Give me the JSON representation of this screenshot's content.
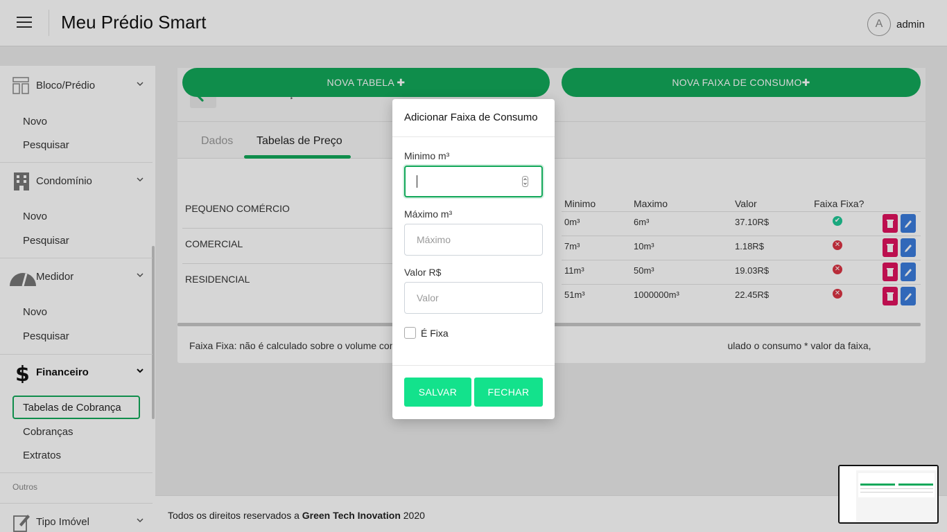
{
  "header": {
    "app_title": "Meu Prédio Smart",
    "avatar_letter": "A",
    "username": "admin"
  },
  "sidebar": {
    "sections": [
      {
        "label": "Bloco/Prédio",
        "items": [
          "Novo",
          "Pesquisar"
        ]
      },
      {
        "label": "Condomínio",
        "items": [
          "Novo",
          "Pesquisar"
        ]
      },
      {
        "label": "Medidor",
        "items": [
          "Novo",
          "Pesquisar"
        ]
      },
      {
        "label": "Financeiro",
        "items": [
          "Tabelas de Cobrança",
          "Cobranças",
          "Extratos"
        ]
      },
      {
        "label": "Tipo Imóvel",
        "items": []
      }
    ],
    "group_label": "Outros"
  },
  "page": {
    "title": "Tabelas de Preços da Concessionária",
    "tabs": [
      "Dados",
      "Tabelas de Preço"
    ],
    "active_tab": "Tabelas de Preço",
    "new_table_button": "NOVA TABELA",
    "new_band_button": "NOVA FAIXA DE CONSUMO",
    "price_tables": [
      "PEQUENO COMÉRCIO",
      "COMERCIAL",
      "RESIDENCIAL"
    ],
    "bands_columns": [
      "Minimo",
      "Maximo",
      "Valor",
      "Faixa Fixa?"
    ],
    "bands": [
      {
        "min": "0m³",
        "max": "6m³",
        "value": "37.10R$",
        "fixed": true
      },
      {
        "min": "7m³",
        "max": "10m³",
        "value": "1.18R$",
        "fixed": false
      },
      {
        "min": "11m³",
        "max": "50m³",
        "value": "19.03R$",
        "fixed": false
      },
      {
        "min": "51m³",
        "max": "1000000m³",
        "value": "22.45R$",
        "fixed": false
      }
    ],
    "note_left": "Faixa Fixa: não é calculado sobre o volume con",
    "note_right": "ulado o consumo * valor da faixa,"
  },
  "footer": {
    "prefix": "Todos os direitos reservados a",
    "company": "Green Tech Inovation",
    "year": "2020"
  },
  "modal": {
    "title": "Adicionar Faixa de Consumo",
    "min_label": "Minimo m³",
    "min_value": "",
    "max_label": "Máximo m³",
    "max_placeholder": "Máximo",
    "value_label": "Valor R$",
    "value_placeholder": "Valor",
    "fixed_label": "É Fixa",
    "fixed_checked": false,
    "save_button": "SALVAR",
    "close_button": "FECHAR"
  },
  "colors": {
    "primary_green": "#13a85a",
    "modal_button": "#13e28c",
    "delete": "#e0135f",
    "edit": "#3b7ddd"
  }
}
